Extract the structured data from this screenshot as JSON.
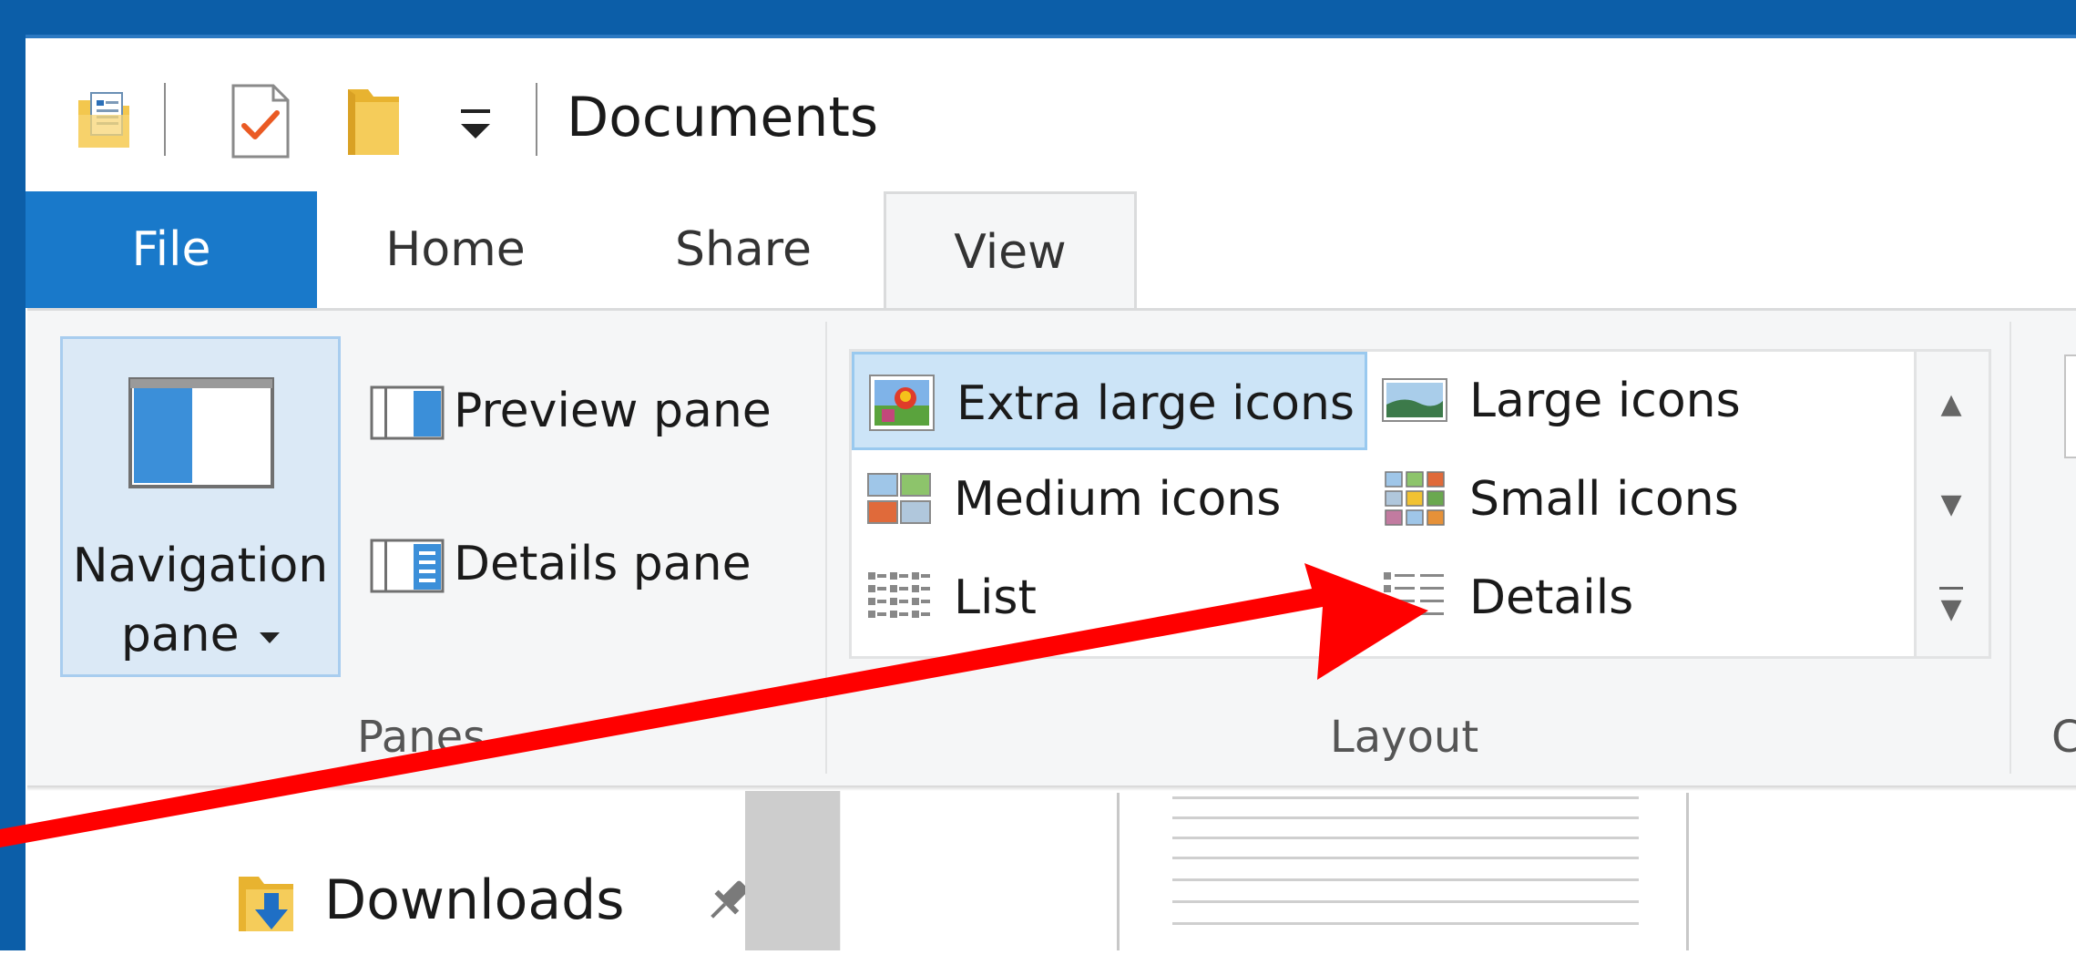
{
  "window": {
    "title": "Documents",
    "colors": {
      "frame": "#0c5ea8",
      "file_tab": "#1979ca",
      "ribbon": "#f5f6f7",
      "selection": "#cce4f7",
      "arrow": "#ff0000"
    }
  },
  "quick_access": {
    "items": [
      "properties-icon",
      "checkmark-document-icon",
      "new-folder-icon",
      "customize-dropdown-icon"
    ]
  },
  "tabs": [
    {
      "label": "File",
      "active": false
    },
    {
      "label": "Home",
      "active": false
    },
    {
      "label": "Share",
      "active": false
    },
    {
      "label": "View",
      "active": true
    }
  ],
  "ribbon": {
    "panes": {
      "group_label": "Panes",
      "navigation_pane_line1": "Navigation",
      "navigation_pane_line2": "pane",
      "preview_pane": "Preview pane",
      "details_pane": "Details pane"
    },
    "layout": {
      "group_label": "Layout",
      "selected": "Extra large icons",
      "items": [
        {
          "label": "Extra large icons",
          "icon": "extra-large-icons-icon"
        },
        {
          "label": "Large icons",
          "icon": "large-icons-icon"
        },
        {
          "label": "Medium icons",
          "icon": "medium-icons-icon"
        },
        {
          "label": "Small icons",
          "icon": "small-icons-icon"
        },
        {
          "label": "List",
          "icon": "list-icon"
        },
        {
          "label": "Details",
          "icon": "details-icon"
        }
      ]
    },
    "next_group_label": "C"
  },
  "navigation": {
    "items": [
      {
        "label": "Downloads",
        "pinned": true
      }
    ]
  }
}
